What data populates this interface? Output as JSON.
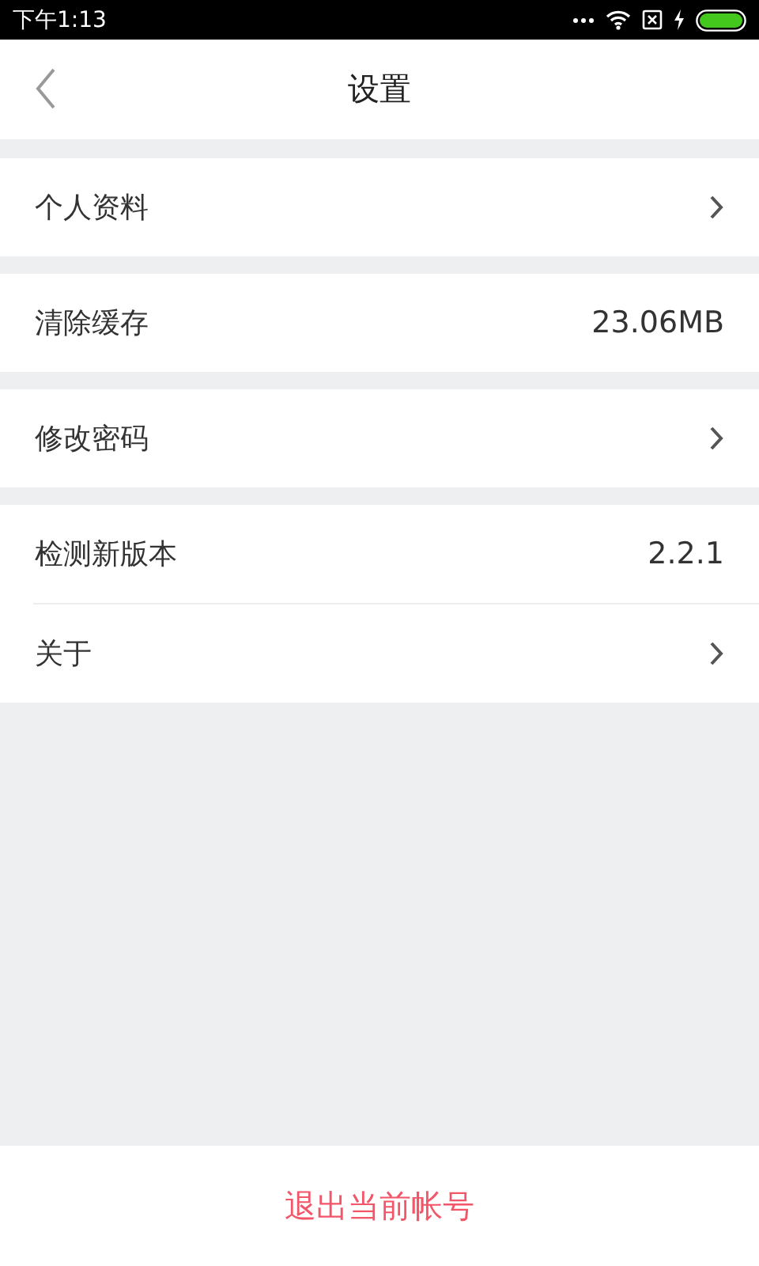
{
  "status_bar": {
    "time": "下午1:13"
  },
  "header": {
    "title": "设置"
  },
  "sections": [
    {
      "rows": [
        {
          "label": "个人资料",
          "kind": "chevron"
        }
      ]
    },
    {
      "rows": [
        {
          "label": "清除缓存",
          "kind": "value",
          "value": "23.06MB"
        }
      ]
    },
    {
      "rows": [
        {
          "label": "修改密码",
          "kind": "chevron"
        }
      ]
    },
    {
      "rows": [
        {
          "label": "检测新版本",
          "kind": "value",
          "value": "2.2.1"
        },
        {
          "label": "关于",
          "kind": "chevron"
        }
      ]
    }
  ],
  "logout_button": "退出当前帐号"
}
